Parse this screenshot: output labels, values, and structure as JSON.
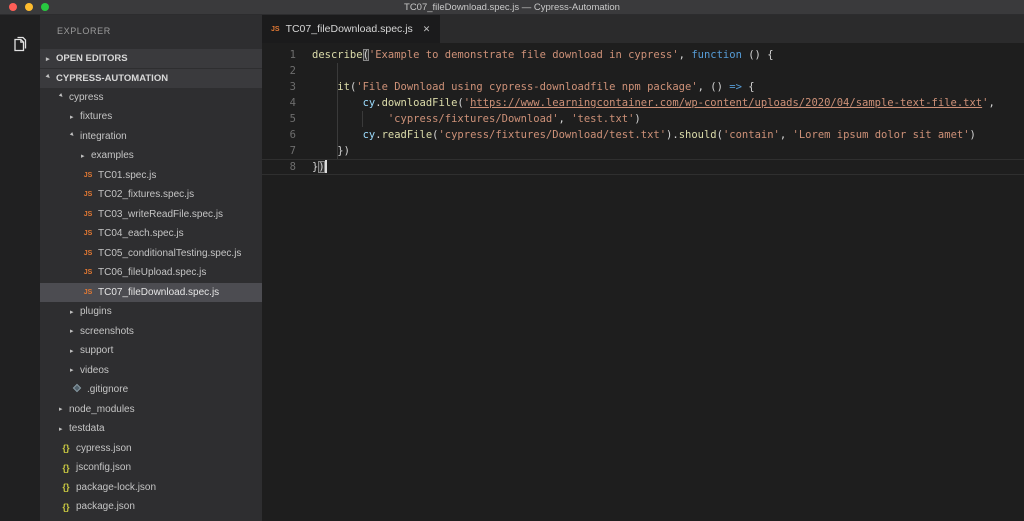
{
  "window": {
    "title": "TC07_fileDownload.spec.js — Cypress-Automation"
  },
  "colors": {
    "accent_js_icon": "#e37933",
    "json_icon": "#cbcb41",
    "string": "#ce9178",
    "keyword": "#569cd6",
    "function_name": "#dcdcaa",
    "variable": "#9cdcfe",
    "editor_bg": "#1e1e1e",
    "sidebar_bg": "#2e2e30"
  },
  "sidebar": {
    "title": "EXPLORER",
    "sections": [
      {
        "label": "OPEN EDITORS",
        "expanded": false
      },
      {
        "label": "CYPRESS-AUTOMATION",
        "expanded": true
      }
    ],
    "tree": [
      {
        "label": "cypress",
        "icon": "folder",
        "depth": 1,
        "expanded": true
      },
      {
        "label": "fixtures",
        "icon": "folder",
        "depth": 2,
        "expanded": false
      },
      {
        "label": "integration",
        "icon": "folder",
        "depth": 2,
        "expanded": true
      },
      {
        "label": "examples",
        "icon": "folder",
        "depth": 3,
        "expanded": false
      },
      {
        "label": "TC01.spec.js",
        "icon": "js",
        "depth": 3
      },
      {
        "label": "TC02_fixtures.spec.js",
        "icon": "js",
        "depth": 3
      },
      {
        "label": "TC03_writeReadFile.spec.js",
        "icon": "js",
        "depth": 3
      },
      {
        "label": "TC04_each.spec.js",
        "icon": "js",
        "depth": 3
      },
      {
        "label": "TC05_conditionalTesting.spec.js",
        "icon": "js",
        "depth": 3
      },
      {
        "label": "TC06_fileUpload.spec.js",
        "icon": "js",
        "depth": 3
      },
      {
        "label": "TC07_fileDownload.spec.js",
        "icon": "js",
        "depth": 3,
        "selected": true
      },
      {
        "label": "plugins",
        "icon": "folder",
        "depth": 2,
        "expanded": false
      },
      {
        "label": "screenshots",
        "icon": "folder",
        "depth": 2,
        "expanded": false
      },
      {
        "label": "support",
        "icon": "folder",
        "depth": 2,
        "expanded": false
      },
      {
        "label": "videos",
        "icon": "folder",
        "depth": 2,
        "expanded": false
      },
      {
        "label": ".gitignore",
        "icon": "git",
        "depth": 2
      },
      {
        "label": "node_modules",
        "icon": "folder",
        "depth": 1,
        "expanded": false
      },
      {
        "label": "testdata",
        "icon": "folder",
        "depth": 1,
        "expanded": false
      },
      {
        "label": "cypress.json",
        "icon": "json",
        "depth": 1
      },
      {
        "label": "jsconfig.json",
        "icon": "json",
        "depth": 1
      },
      {
        "label": "package-lock.json",
        "icon": "json",
        "depth": 1
      },
      {
        "label": "package.json",
        "icon": "json",
        "depth": 1
      }
    ]
  },
  "editor": {
    "tab": {
      "label": "TC07_fileDownload.spec.js",
      "icon": "js",
      "close_glyph": "✕"
    },
    "active_line": 8,
    "lines": [
      {
        "n": 1,
        "tokens": [
          [
            "describe",
            "fn"
          ],
          [
            "(",
            "bm"
          ],
          [
            "'Example to demonstrate file download in cypress'",
            "str"
          ],
          [
            ", ",
            "pln"
          ],
          [
            "function",
            "kw"
          ],
          [
            " () {",
            "pln"
          ]
        ]
      },
      {
        "n": 2,
        "tokens": []
      },
      {
        "n": 3,
        "tokens": [
          [
            "    ",
            "pln"
          ],
          [
            "it",
            "fn"
          ],
          [
            "(",
            "pln"
          ],
          [
            "'File Download using cypress-downloadfile npm package'",
            "str"
          ],
          [
            ", () ",
            "pln"
          ],
          [
            "=>",
            "kw"
          ],
          [
            " {",
            "pln"
          ]
        ]
      },
      {
        "n": 4,
        "tokens": [
          [
            "        ",
            "pln"
          ],
          [
            "cy",
            "var"
          ],
          [
            ".",
            "pln"
          ],
          [
            "downloadFile",
            "fn"
          ],
          [
            "(",
            "pln"
          ],
          [
            "'",
            "str"
          ],
          [
            "https://www.learningcontainer.com/wp-content/uploads/2020/04/sample-text-file.txt",
            "url"
          ],
          [
            "'",
            "str"
          ],
          [
            ",",
            "pln"
          ]
        ]
      },
      {
        "n": 5,
        "tokens": [
          [
            "            ",
            "pln"
          ],
          [
            "'cypress/fixtures/Download'",
            "str"
          ],
          [
            ", ",
            "pln"
          ],
          [
            "'test.txt'",
            "str"
          ],
          [
            ")",
            "pln"
          ]
        ]
      },
      {
        "n": 6,
        "tokens": [
          [
            "        ",
            "pln"
          ],
          [
            "cy",
            "var"
          ],
          [
            ".",
            "pln"
          ],
          [
            "readFile",
            "fn"
          ],
          [
            "(",
            "pln"
          ],
          [
            "'cypress/fixtures/Download/test.txt'",
            "str"
          ],
          [
            ").",
            "pln"
          ],
          [
            "should",
            "fn"
          ],
          [
            "(",
            "pln"
          ],
          [
            "'contain'",
            "str"
          ],
          [
            ", ",
            "pln"
          ],
          [
            "'Lorem ipsum dolor sit amet'",
            "str"
          ],
          [
            ")",
            "pln"
          ]
        ]
      },
      {
        "n": 7,
        "tokens": [
          [
            "    })",
            "pln"
          ]
        ]
      },
      {
        "n": 8,
        "tokens": [
          [
            "}",
            "pln"
          ],
          [
            ")",
            "bm"
          ],
          [
            "",
            "cursor"
          ]
        ]
      }
    ]
  }
}
